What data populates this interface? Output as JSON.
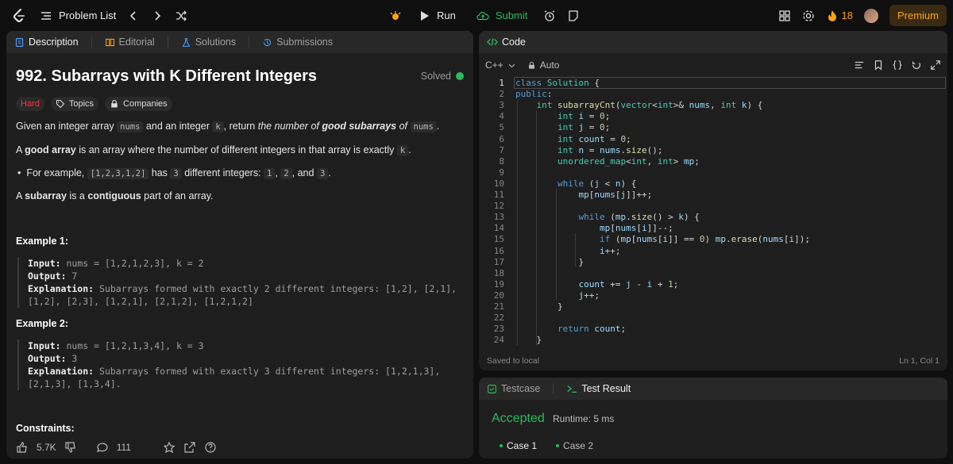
{
  "nav": {
    "problem_list": "Problem List",
    "run": "Run",
    "submit": "Submit",
    "streak": "18",
    "premium": "Premium"
  },
  "left_tabs": {
    "description": "Description",
    "editorial": "Editorial",
    "solutions": "Solutions",
    "submissions": "Submissions"
  },
  "problem": {
    "title": "992. Subarrays with K Different Integers",
    "status": "Solved",
    "difficulty": "Hard",
    "topics": "Topics",
    "companies": "Companies",
    "p1": {
      "a": "Given an integer array ",
      "nums": "nums",
      "b": " and an integer ",
      "k": "k",
      "c": ", return ",
      "d": "the number of ",
      "e": "good subarrays",
      "f": " of ",
      "nums2": "nums",
      "g": "."
    },
    "p2": {
      "a": "A ",
      "b": "good array",
      "c": " is an array where the number of different integers in that array is exactly ",
      "k": "k",
      "d": "."
    },
    "bullet": {
      "a": "For example, ",
      "arr": "[1,2,3,1,2]",
      "b": " has ",
      "n": "3",
      "c": " different integers: ",
      "v1": "1",
      "d": ", ",
      "v2": "2",
      "e": ", and ",
      "v3": "3",
      "f": "."
    },
    "p3": {
      "a": "A ",
      "b": "subarray",
      "c": " is a ",
      "d": "contiguous",
      "e": " part of an array."
    },
    "example1": {
      "heading": "Example 1:",
      "input_label": "Input:",
      "input": " nums = [1,2,1,2,3], k = 2",
      "output_label": "Output:",
      "output": " 7",
      "expl_label": "Explanation:",
      "expl1": " Subarrays formed with exactly 2 different integers: [1,2], [2,1],",
      "expl2": "[1,2], [2,3], [1,2,1], [2,1,2], [1,2,1,2]"
    },
    "example2": {
      "heading": "Example 2:",
      "input_label": "Input:",
      "input": " nums = [1,2,1,3,4], k = 3",
      "output_label": "Output:",
      "output": " 3",
      "expl_label": "Explanation:",
      "expl1": " Subarrays formed with exactly 3 different integers: [1,2,1,3],",
      "expl2": "[2,1,3], [1,3,4]."
    },
    "constraints": "Constraints:",
    "likes": "5.7K",
    "comments": "111"
  },
  "code_panel": {
    "title": "Code",
    "language": "C++",
    "mode": "Auto",
    "saved": "Saved to local",
    "cursor": "Ln 1, Col 1",
    "lines": [
      "class Solution {",
      "public:",
      "    int subarrayCnt(vector<int>& nums, int k) {",
      "        int i = 0;",
      "        int j = 0;",
      "        int count = 0;",
      "        int n = nums.size();",
      "        unordered_map<int, int> mp;",
      "",
      "        while (j < n) {",
      "            mp[nums[j]]++;",
      "",
      "            while (mp.size() > k) {",
      "                mp[nums[i]]--;",
      "                if (mp[nums[i]] == 0) mp.erase(nums[i]);",
      "                i++;",
      "            }",
      "",
      "            count += j - i + 1;",
      "            j++;",
      "        }",
      "",
      "        return count;",
      "    }"
    ]
  },
  "result_panel": {
    "testcase": "Testcase",
    "test_result": "Test Result",
    "verdict": "Accepted",
    "runtime": "Runtime: 5 ms",
    "case1": "Case 1",
    "case2": "Case 2"
  }
}
